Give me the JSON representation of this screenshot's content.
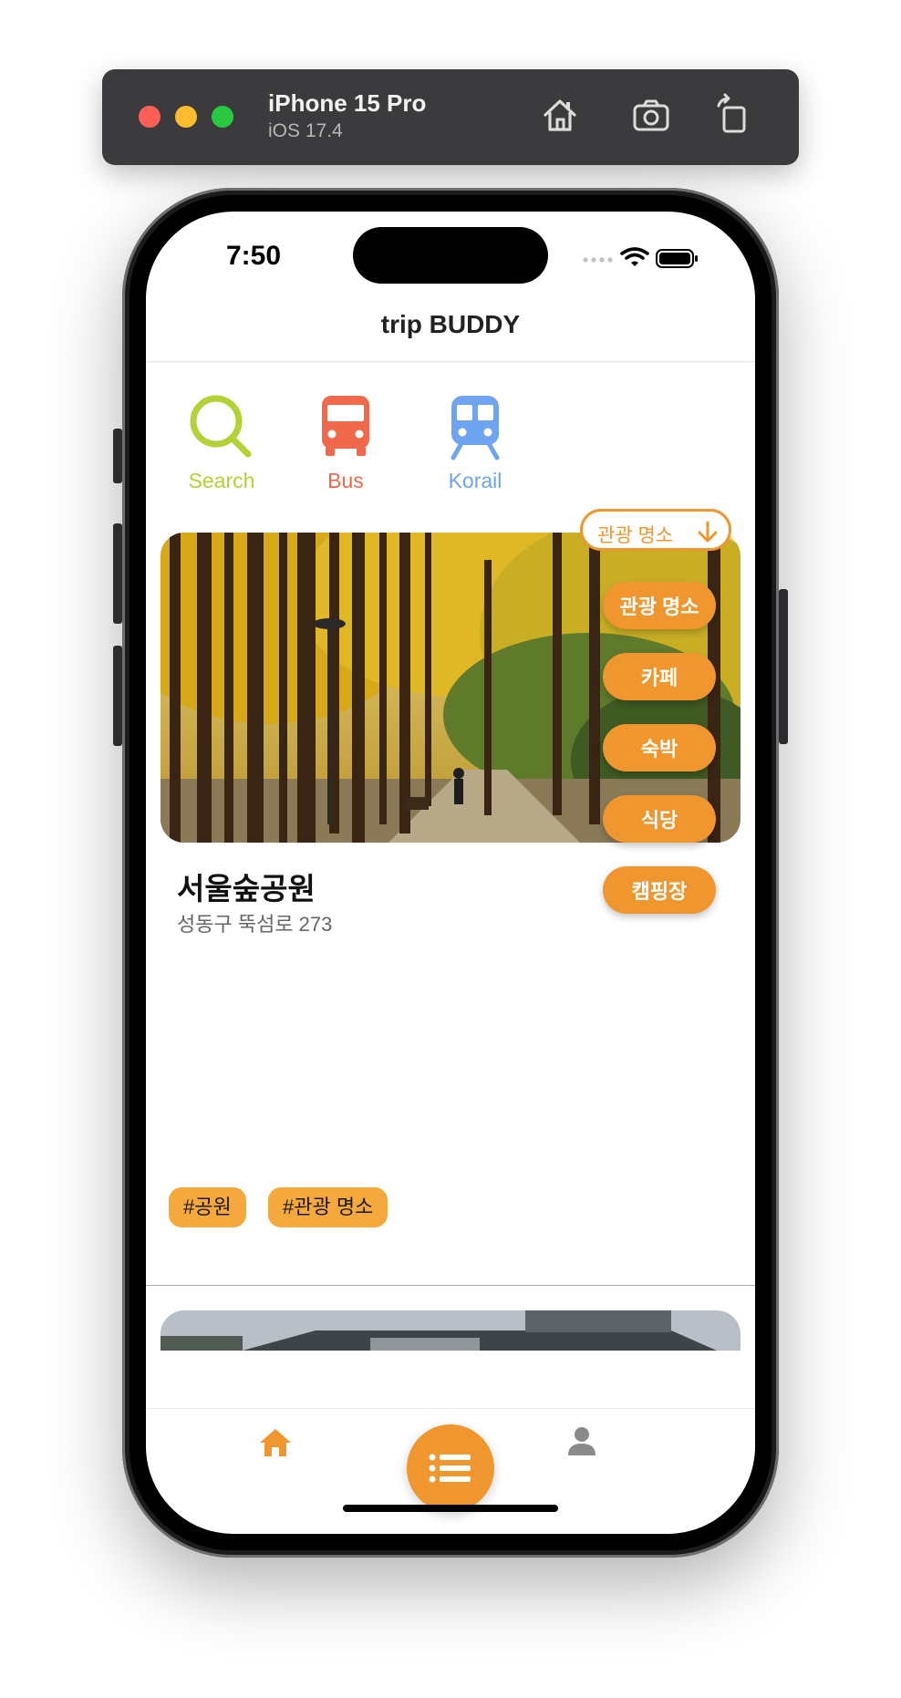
{
  "simulator": {
    "device_name": "iPhone 15 Pro",
    "os_version": "iOS 17.4",
    "toolbar_icons": [
      "home-icon",
      "screenshot-icon",
      "rotate-icon"
    ]
  },
  "status_bar": {
    "time": "7:50",
    "icons": [
      "signal-icon",
      "wifi-icon",
      "battery-icon"
    ]
  },
  "nav": {
    "title": "trip BUDDY"
  },
  "quick_actions": [
    {
      "label": "Search",
      "icon": "search-icon",
      "color": "#b3d236"
    },
    {
      "label": "Bus",
      "icon": "bus-icon",
      "color": "#f0694a"
    },
    {
      "label": "Korail",
      "icon": "train-icon",
      "color": "#6fa4f0"
    }
  ],
  "category_dropdown": {
    "selected": "관광 명소",
    "icon": "arrow-down-icon",
    "options": [
      "관광 명소",
      "카페",
      "숙박",
      "식당",
      "캠핑장"
    ]
  },
  "place": {
    "name": "서울숲공원",
    "address": "성동구 뚝섬로 273",
    "tags": [
      "#공원",
      "#관광 명소"
    ]
  },
  "tab_bar": {
    "home_icon": "home-icon",
    "center_icon": "list-icon",
    "profile_icon": "person-icon"
  },
  "colors": {
    "accent": "#f0962f",
    "tag_bg": "#f5a93c"
  }
}
